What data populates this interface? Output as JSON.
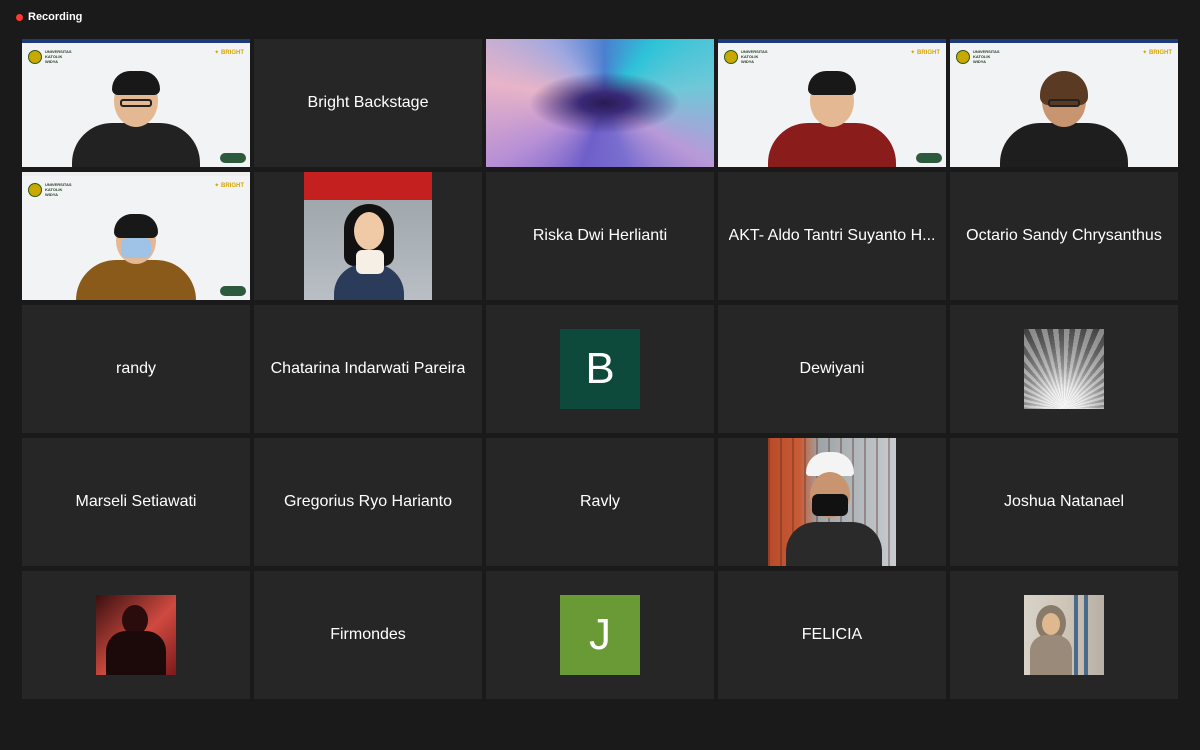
{
  "recording": {
    "label": "Recording",
    "dot_color": "#ff3b30"
  },
  "participants": [
    {
      "name": "",
      "kind": "video",
      "active": true,
      "icon": "speaker-video"
    },
    {
      "name": "Bright Backstage",
      "kind": "name"
    },
    {
      "name": "",
      "kind": "gradient-avatar",
      "icon": "abstract-gradient"
    },
    {
      "name": "",
      "kind": "video",
      "icon": "participant-video"
    },
    {
      "name": "",
      "kind": "video",
      "icon": "participant-video"
    },
    {
      "name": "",
      "kind": "video",
      "icon": "participant-video-masked"
    },
    {
      "name": "",
      "kind": "photo-avatar",
      "icon": "profile-photo"
    },
    {
      "name": "Riska Dwi Herlianti",
      "kind": "name"
    },
    {
      "name": "AKT- Aldo Tantri Suyanto H...",
      "kind": "name"
    },
    {
      "name": "Octario Sandy Chrysanthus",
      "kind": "name"
    },
    {
      "name": "randy",
      "kind": "name"
    },
    {
      "name": "Chatarina Indarwati Pareira",
      "kind": "name"
    },
    {
      "name": "",
      "kind": "letter-avatar",
      "letter": "B",
      "color": "#0e4a3c"
    },
    {
      "name": "Dewiyani",
      "kind": "name"
    },
    {
      "name": "",
      "kind": "photo-avatar",
      "icon": "peacock-photo"
    },
    {
      "name": "Marseli Setiawati",
      "kind": "name"
    },
    {
      "name": "Gregorius Ryo Harianto",
      "kind": "name"
    },
    {
      "name": "Ravly",
      "kind": "name"
    },
    {
      "name": "",
      "kind": "photo-avatar",
      "icon": "hardhat-profile-photo"
    },
    {
      "name": "Joshua Natanael",
      "kind": "name"
    },
    {
      "name": "",
      "kind": "photo-avatar",
      "icon": "red-light-profile-photo"
    },
    {
      "name": "Firmondes",
      "kind": "name"
    },
    {
      "name": "",
      "kind": "letter-avatar",
      "letter": "J",
      "color": "#6a9a36"
    },
    {
      "name": "FELICIA",
      "kind": "name"
    },
    {
      "name": "",
      "kind": "photo-avatar",
      "icon": "hijab-profile-photo"
    }
  ]
}
